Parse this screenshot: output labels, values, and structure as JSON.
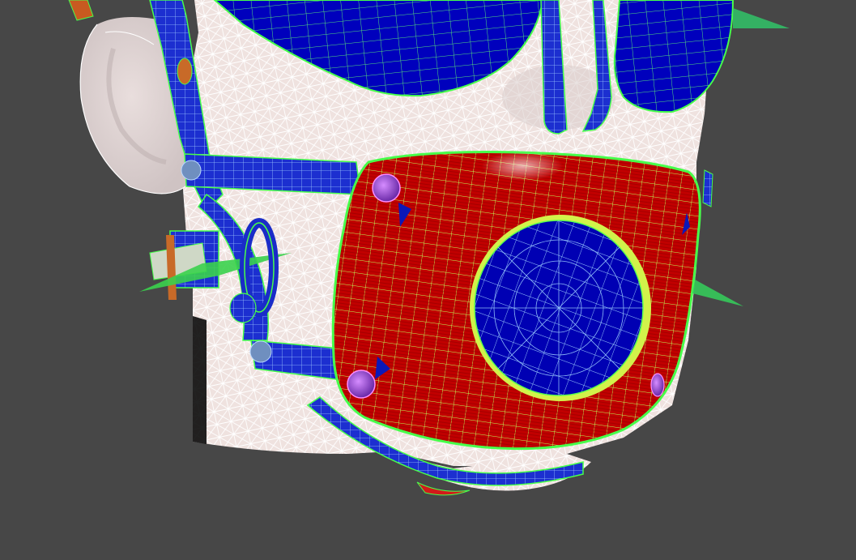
{
  "viewport": {
    "view": "perspective",
    "display_mode": "wireframe-over-shaded",
    "background_color": "#474747"
  },
  "scene": {
    "objects": [
      {
        "name": "head",
        "color": "#efe4e2",
        "wire_color": "#ffffff"
      },
      {
        "name": "mask-shell",
        "color": "#c40000",
        "wire_color": "#c8ff57"
      },
      {
        "name": "mask-filter",
        "color": "#0000b8",
        "wire_color": "#9bc8ff"
      },
      {
        "name": "goggles",
        "color": "#0000b8",
        "wire_color": "#46e35a"
      },
      {
        "name": "straps",
        "color": "#1a2cc8",
        "wire_color": "#56f263"
      },
      {
        "name": "rivets",
        "color": "#9b3fc9",
        "wire_color": "#ff8cff"
      }
    ],
    "selection_outline_color": "#36ff3c"
  }
}
